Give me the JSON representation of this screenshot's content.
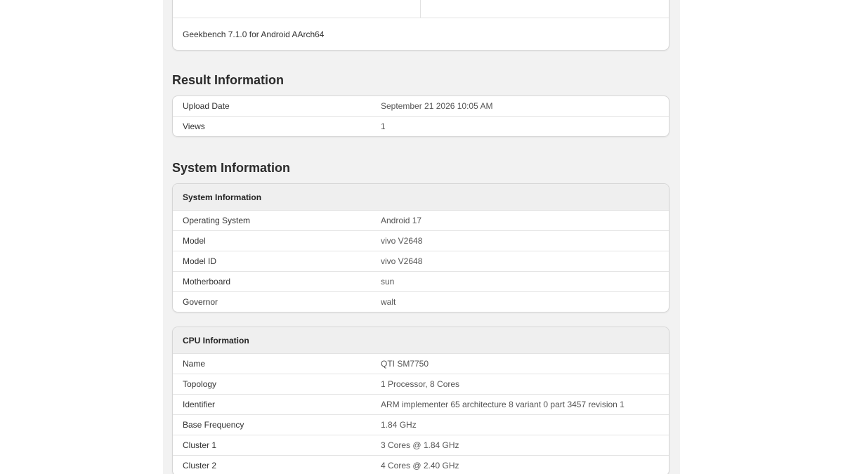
{
  "benchmark": {
    "version_label": "Geekbench 7.1.0 for Android AArch64"
  },
  "result_information": {
    "title": "Result Information",
    "rows": [
      {
        "label": "Upload Date",
        "value": "September 21 2026 10:05 AM"
      },
      {
        "label": "Views",
        "value": "1"
      }
    ]
  },
  "system_section": {
    "title": "System Information"
  },
  "system_information": {
    "header": "System Information",
    "rows": [
      {
        "label": "Operating System",
        "value": "Android 17"
      },
      {
        "label": "Model",
        "value": "vivo V2648"
      },
      {
        "label": "Model ID",
        "value": "vivo V2648"
      },
      {
        "label": "Motherboard",
        "value": "sun"
      },
      {
        "label": "Governor",
        "value": "walt"
      }
    ]
  },
  "cpu_information": {
    "header": "CPU Information",
    "rows": [
      {
        "label": "Name",
        "value": "QTI SM7750"
      },
      {
        "label": "Topology",
        "value": "1 Processor, 8 Cores"
      },
      {
        "label": "Identifier",
        "value": "ARM implementer 65 architecture 8 variant 0 part 3457 revision 1"
      },
      {
        "label": "Base Frequency",
        "value": "1.84 GHz"
      },
      {
        "label": "Cluster 1",
        "value": "3 Cores @ 1.84 GHz"
      },
      {
        "label": "Cluster 2",
        "value": "4 Cores @ 2.40 GHz"
      }
    ]
  }
}
